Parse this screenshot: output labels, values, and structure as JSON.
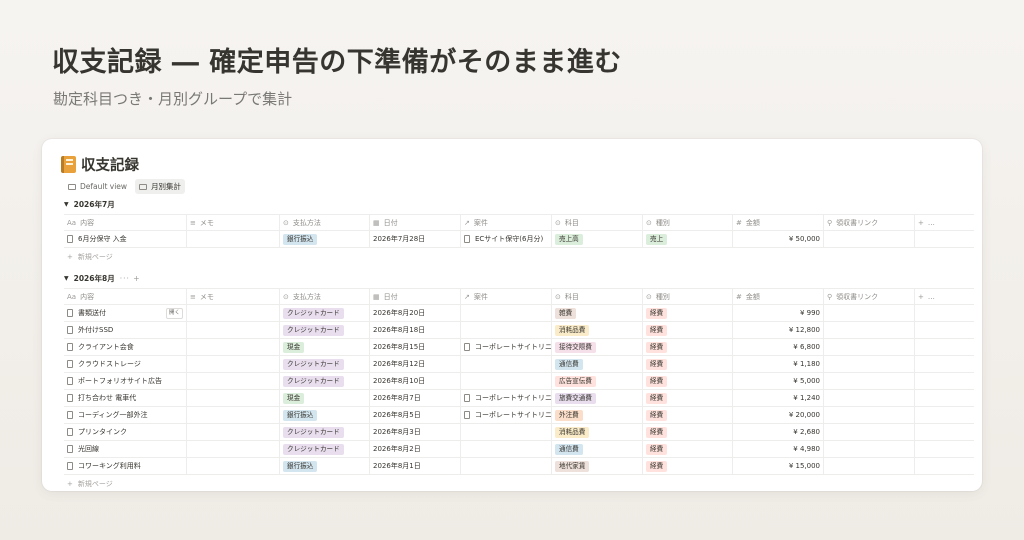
{
  "hero": {
    "title": "収支記録 ― 確定申告の下準備がそのまま進む",
    "subtitle": "勘定科目つき・月別グループで集計"
  },
  "database": {
    "icon": "notebook-icon",
    "title": "収支記録",
    "views": [
      {
        "label": "Default view",
        "active": false
      },
      {
        "label": "月別集計",
        "active": true
      }
    ]
  },
  "columns": [
    {
      "icon": "Aa",
      "label": "内容"
    },
    {
      "icon": "≡",
      "label": "メモ"
    },
    {
      "icon": "⊙",
      "label": "支払方法"
    },
    {
      "icon": "▦",
      "label": "日付"
    },
    {
      "icon": "↗",
      "label": "案件"
    },
    {
      "icon": "⊙",
      "label": "科目"
    },
    {
      "icon": "⊙",
      "label": "種別"
    },
    {
      "icon": "#",
      "label": "金額"
    },
    {
      "icon": "⚲",
      "label": "領収書リンク"
    },
    {
      "icon": "+",
      "label": "…"
    }
  ],
  "colors": {
    "tag_blue": "#d3e5ef",
    "tag_purple": "#e8deee",
    "tag_green": "#dbeddb",
    "tag_yellow": "#fbecc9",
    "tag_red": "#ffe2dd",
    "tag_orange": "#fadec9",
    "tag_pink": "#f5e0e9",
    "tag_brown": "#eee0da",
    "tag_text": "#37352f"
  },
  "groups": [
    {
      "label": "2026年7月",
      "tools": "",
      "new_page": "新規ページ",
      "rows": [
        {
          "name": "6月分保守 入金",
          "memo": "",
          "payment": "銀行振込",
          "payment_color": "#d3e5ef",
          "date": "2026年7月28日",
          "project": "ECサイト保守(6月分)",
          "account": "売上高",
          "account_color": "#dbeddb",
          "kind": "売上",
          "kind_color": "#dbeddb",
          "amount": "¥ 50,000",
          "receipt": ""
        }
      ]
    },
    {
      "label": "2026年8月",
      "tools": "··· +",
      "new_page": "新規ページ",
      "rows": [
        {
          "name": "書類送付",
          "memo": "",
          "payment": "クレジットカード",
          "payment_color": "#e8deee",
          "date": "2026年8月20日",
          "project": "",
          "account": "雑費",
          "account_color": "#eee0da",
          "kind": "経費",
          "kind_color": "#ffe2dd",
          "amount": "¥ 990",
          "receipt": "",
          "open": "開く"
        },
        {
          "name": "外付けSSD",
          "memo": "",
          "payment": "クレジットカード",
          "payment_color": "#e8deee",
          "date": "2026年8月18日",
          "project": "",
          "account": "消耗品費",
          "account_color": "#fbecc9",
          "kind": "経費",
          "kind_color": "#ffe2dd",
          "amount": "¥ 12,800",
          "receipt": ""
        },
        {
          "name": "クライアント会食",
          "memo": "",
          "payment": "現金",
          "payment_color": "#dbeddb",
          "date": "2026年8月15日",
          "project": "コーポレートサイトリニュ",
          "account": "接待交際費",
          "account_color": "#f5e0e9",
          "kind": "経費",
          "kind_color": "#ffe2dd",
          "amount": "¥ 6,800",
          "receipt": ""
        },
        {
          "name": "クラウドストレージ",
          "memo": "",
          "payment": "クレジットカード",
          "payment_color": "#e8deee",
          "date": "2026年8月12日",
          "project": "",
          "account": "通信費",
          "account_color": "#d3e5ef",
          "kind": "経費",
          "kind_color": "#ffe2dd",
          "amount": "¥ 1,180",
          "receipt": ""
        },
        {
          "name": "ポートフォリオサイト広告",
          "memo": "",
          "payment": "クレジットカード",
          "payment_color": "#e8deee",
          "date": "2026年8月10日",
          "project": "",
          "account": "広告宣伝費",
          "account_color": "#ffe2dd",
          "kind": "経費",
          "kind_color": "#ffe2dd",
          "amount": "¥ 5,000",
          "receipt": ""
        },
        {
          "name": "打ち合わせ 電車代",
          "memo": "",
          "payment": "現金",
          "payment_color": "#dbeddb",
          "date": "2026年8月7日",
          "project": "コーポレートサイトリニュ",
          "account": "旅費交通費",
          "account_color": "#e8deee",
          "kind": "経費",
          "kind_color": "#ffe2dd",
          "amount": "¥ 1,240",
          "receipt": ""
        },
        {
          "name": "コーディング一部外注",
          "memo": "",
          "payment": "銀行振込",
          "payment_color": "#d3e5ef",
          "date": "2026年8月5日",
          "project": "コーポレートサイトリニュ",
          "account": "外注費",
          "account_color": "#fadec9",
          "kind": "経費",
          "kind_color": "#ffe2dd",
          "amount": "¥ 20,000",
          "receipt": ""
        },
        {
          "name": "プリンタインク",
          "memo": "",
          "payment": "クレジットカード",
          "payment_color": "#e8deee",
          "date": "2026年8月3日",
          "project": "",
          "account": "消耗品費",
          "account_color": "#fbecc9",
          "kind": "経費",
          "kind_color": "#ffe2dd",
          "amount": "¥ 2,680",
          "receipt": ""
        },
        {
          "name": "光回線",
          "memo": "",
          "payment": "クレジットカード",
          "payment_color": "#e8deee",
          "date": "2026年8月2日",
          "project": "",
          "account": "通信費",
          "account_color": "#d3e5ef",
          "kind": "経費",
          "kind_color": "#ffe2dd",
          "amount": "¥ 4,980",
          "receipt": ""
        },
        {
          "name": "コワーキング利用料",
          "memo": "",
          "payment": "銀行振込",
          "payment_color": "#d3e5ef",
          "date": "2026年8月1日",
          "project": "",
          "account": "地代家賃",
          "account_color": "#eee0da",
          "kind": "経費",
          "kind_color": "#ffe2dd",
          "amount": "¥ 15,000",
          "receipt": ""
        }
      ]
    }
  ]
}
